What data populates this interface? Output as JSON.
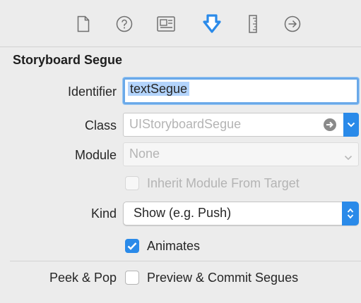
{
  "tabs": [
    {
      "icon": "file-icon"
    },
    {
      "icon": "help-circle-icon"
    },
    {
      "icon": "identity-card-icon"
    },
    {
      "icon": "attributes-arrow-icon",
      "active": true
    },
    {
      "icon": "ruler-icon"
    },
    {
      "icon": "connections-arrow-icon"
    }
  ],
  "accent_color": "#2a8ae9",
  "section": {
    "title": "Storyboard Segue"
  },
  "identifier": {
    "label": "Identifier",
    "value": "textSegue"
  },
  "class": {
    "label": "Class",
    "placeholder": "UIStoryboardSegue"
  },
  "module": {
    "label": "Module",
    "placeholder": "None"
  },
  "inherit": {
    "label": "Inherit Module From Target",
    "checked": false,
    "enabled": false
  },
  "kind": {
    "label": "Kind",
    "value": "Show (e.g. Push)"
  },
  "animates": {
    "label": "Animates",
    "checked": true
  },
  "peek": {
    "label": "Peek & Pop",
    "option_label": "Preview & Commit Segues",
    "checked": false
  }
}
